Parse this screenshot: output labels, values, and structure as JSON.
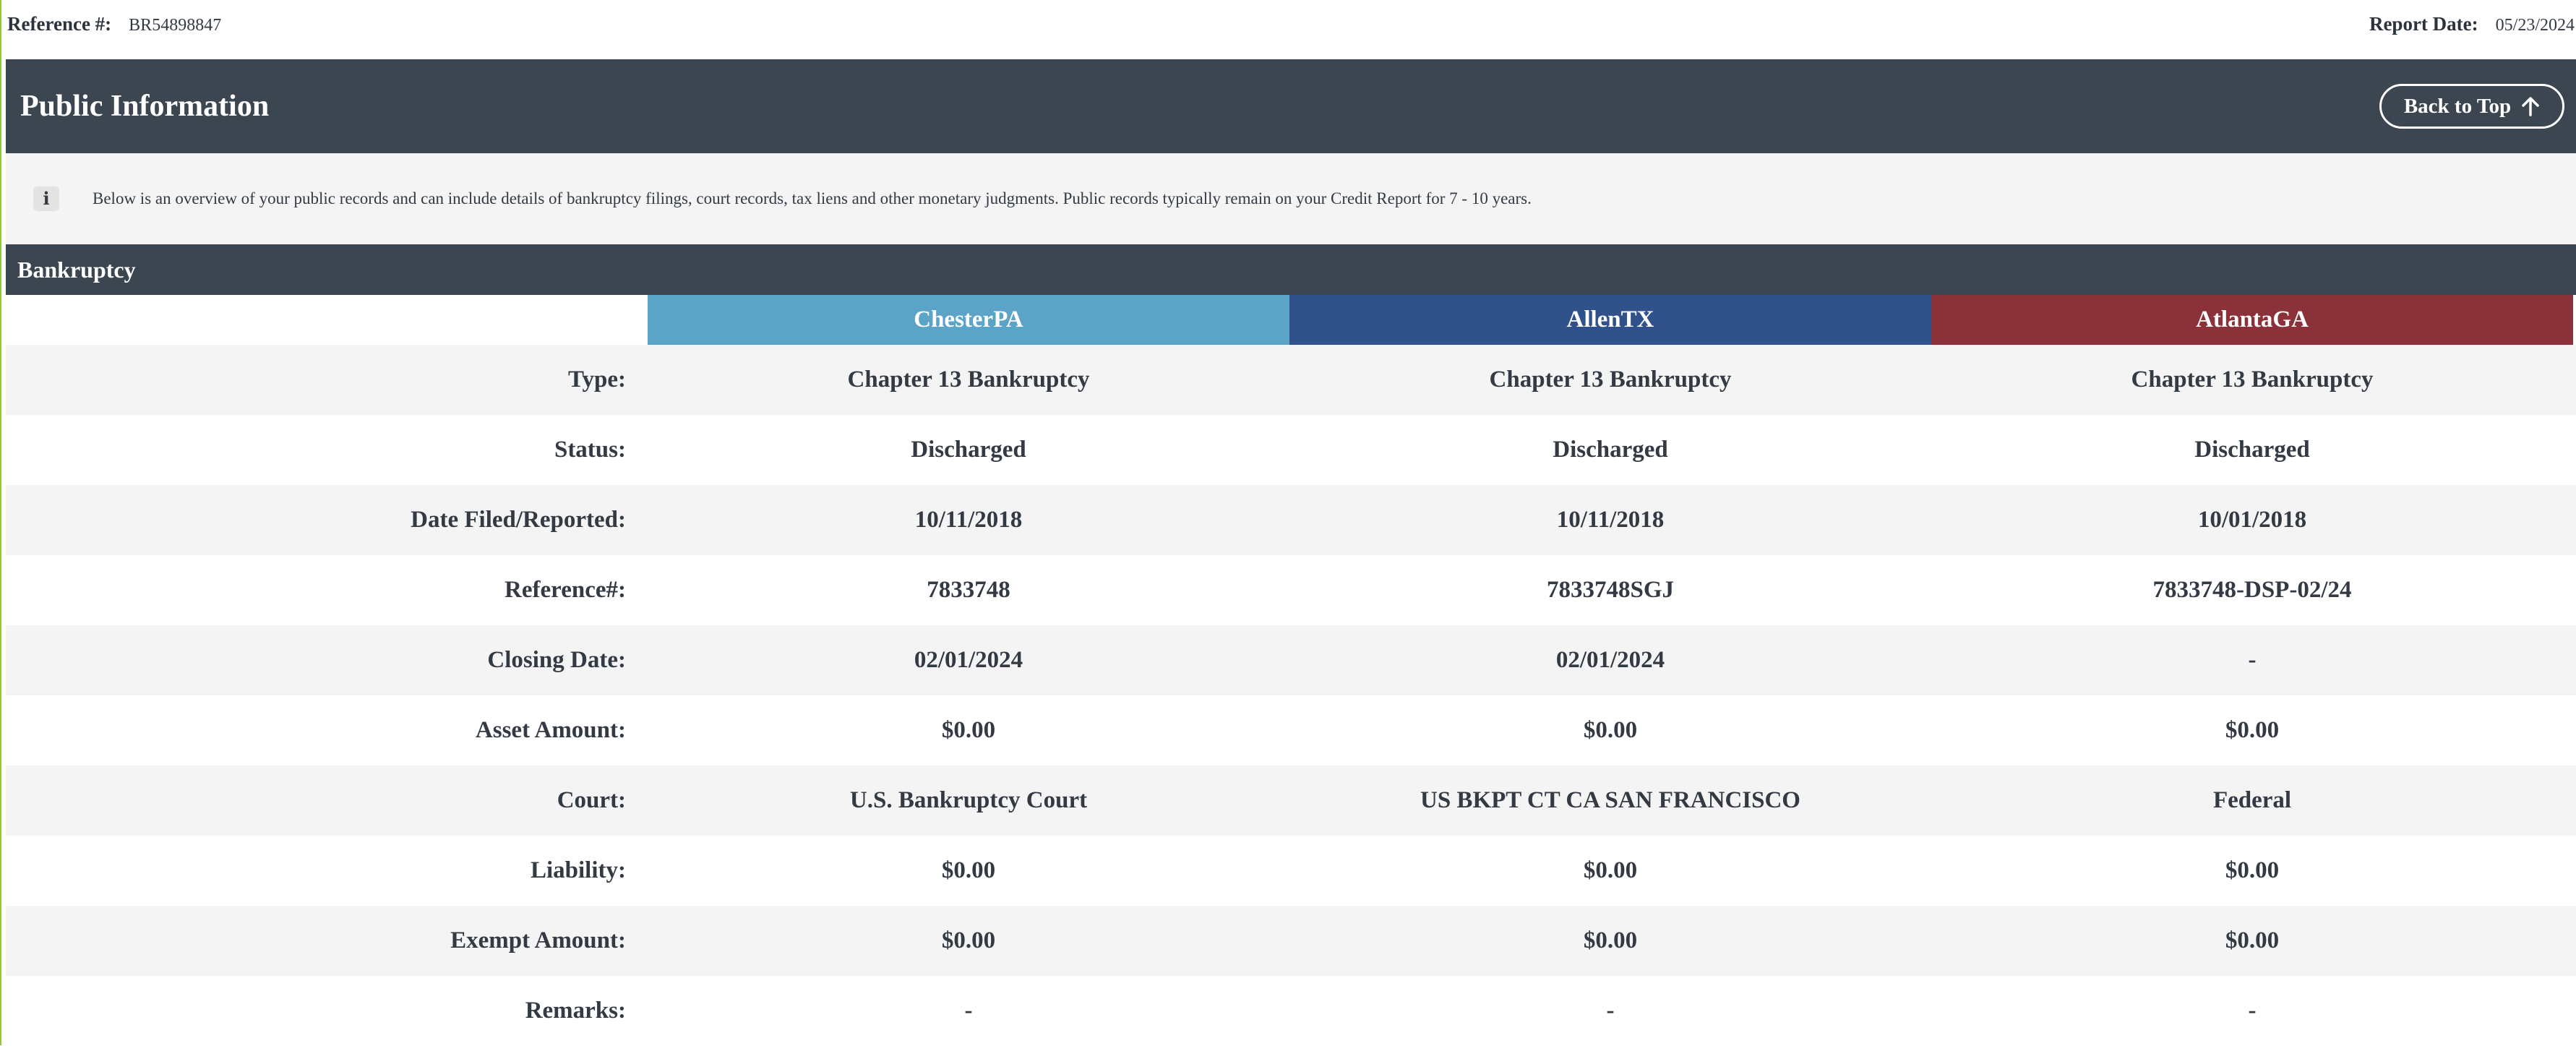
{
  "top": {
    "reference_label": "Reference #:",
    "reference_value": "BR54898847",
    "report_date_label": "Report Date:",
    "report_date_value": "05/23/2024"
  },
  "header": {
    "title": "Public Information",
    "back_to_top_label": "Back to Top",
    "back_to_top_icon": "arrow-up-icon"
  },
  "info": {
    "icon": "info-icon",
    "icon_glyph": "i",
    "text": "Below is an overview of your public records and can include details of bankruptcy filings, court records, tax liens and other monetary judgments. Public records typically remain on your Credit Report for 7 - 10 years."
  },
  "section": {
    "title": "Bankruptcy"
  },
  "bureaus": [
    {
      "name": "ChesterPA",
      "color": "#5ba3c7"
    },
    {
      "name": "AllenTX",
      "color": "#30518a"
    },
    {
      "name": "AtlantaGA",
      "color": "#8b3139"
    }
  ],
  "rows": [
    {
      "label": "Type:",
      "values": [
        "Chapter 13 Bankruptcy",
        "Chapter 13 Bankruptcy",
        "Chapter 13 Bankruptcy"
      ]
    },
    {
      "label": "Status:",
      "values": [
        "Discharged",
        "Discharged",
        "Discharged"
      ]
    },
    {
      "label": "Date Filed/Reported:",
      "values": [
        "10/11/2018",
        "10/11/2018",
        "10/01/2018"
      ]
    },
    {
      "label": "Reference#:",
      "values": [
        "7833748",
        "7833748SGJ",
        "7833748-DSP-02/24"
      ]
    },
    {
      "label": "Closing Date:",
      "values": [
        "02/01/2024",
        "02/01/2024",
        "-"
      ]
    },
    {
      "label": "Asset Amount:",
      "values": [
        "$0.00",
        "$0.00",
        "$0.00"
      ]
    },
    {
      "label": "Court:",
      "values": [
        "U.S. Bankruptcy Court",
        "US BKPT CT CA SAN FRANCISCO",
        "Federal"
      ]
    },
    {
      "label": "Liability:",
      "values": [
        "$0.00",
        "$0.00",
        "$0.00"
      ]
    },
    {
      "label": "Exempt Amount:",
      "values": [
        "$0.00",
        "$0.00",
        "$0.00"
      ]
    },
    {
      "label": "Remarks:",
      "values": [
        "-",
        "-",
        "-"
      ]
    }
  ],
  "colors": {
    "header_bg": "#3b4651",
    "row_shaded": "#f4f4f4",
    "left_accent": "#8dc63f"
  }
}
